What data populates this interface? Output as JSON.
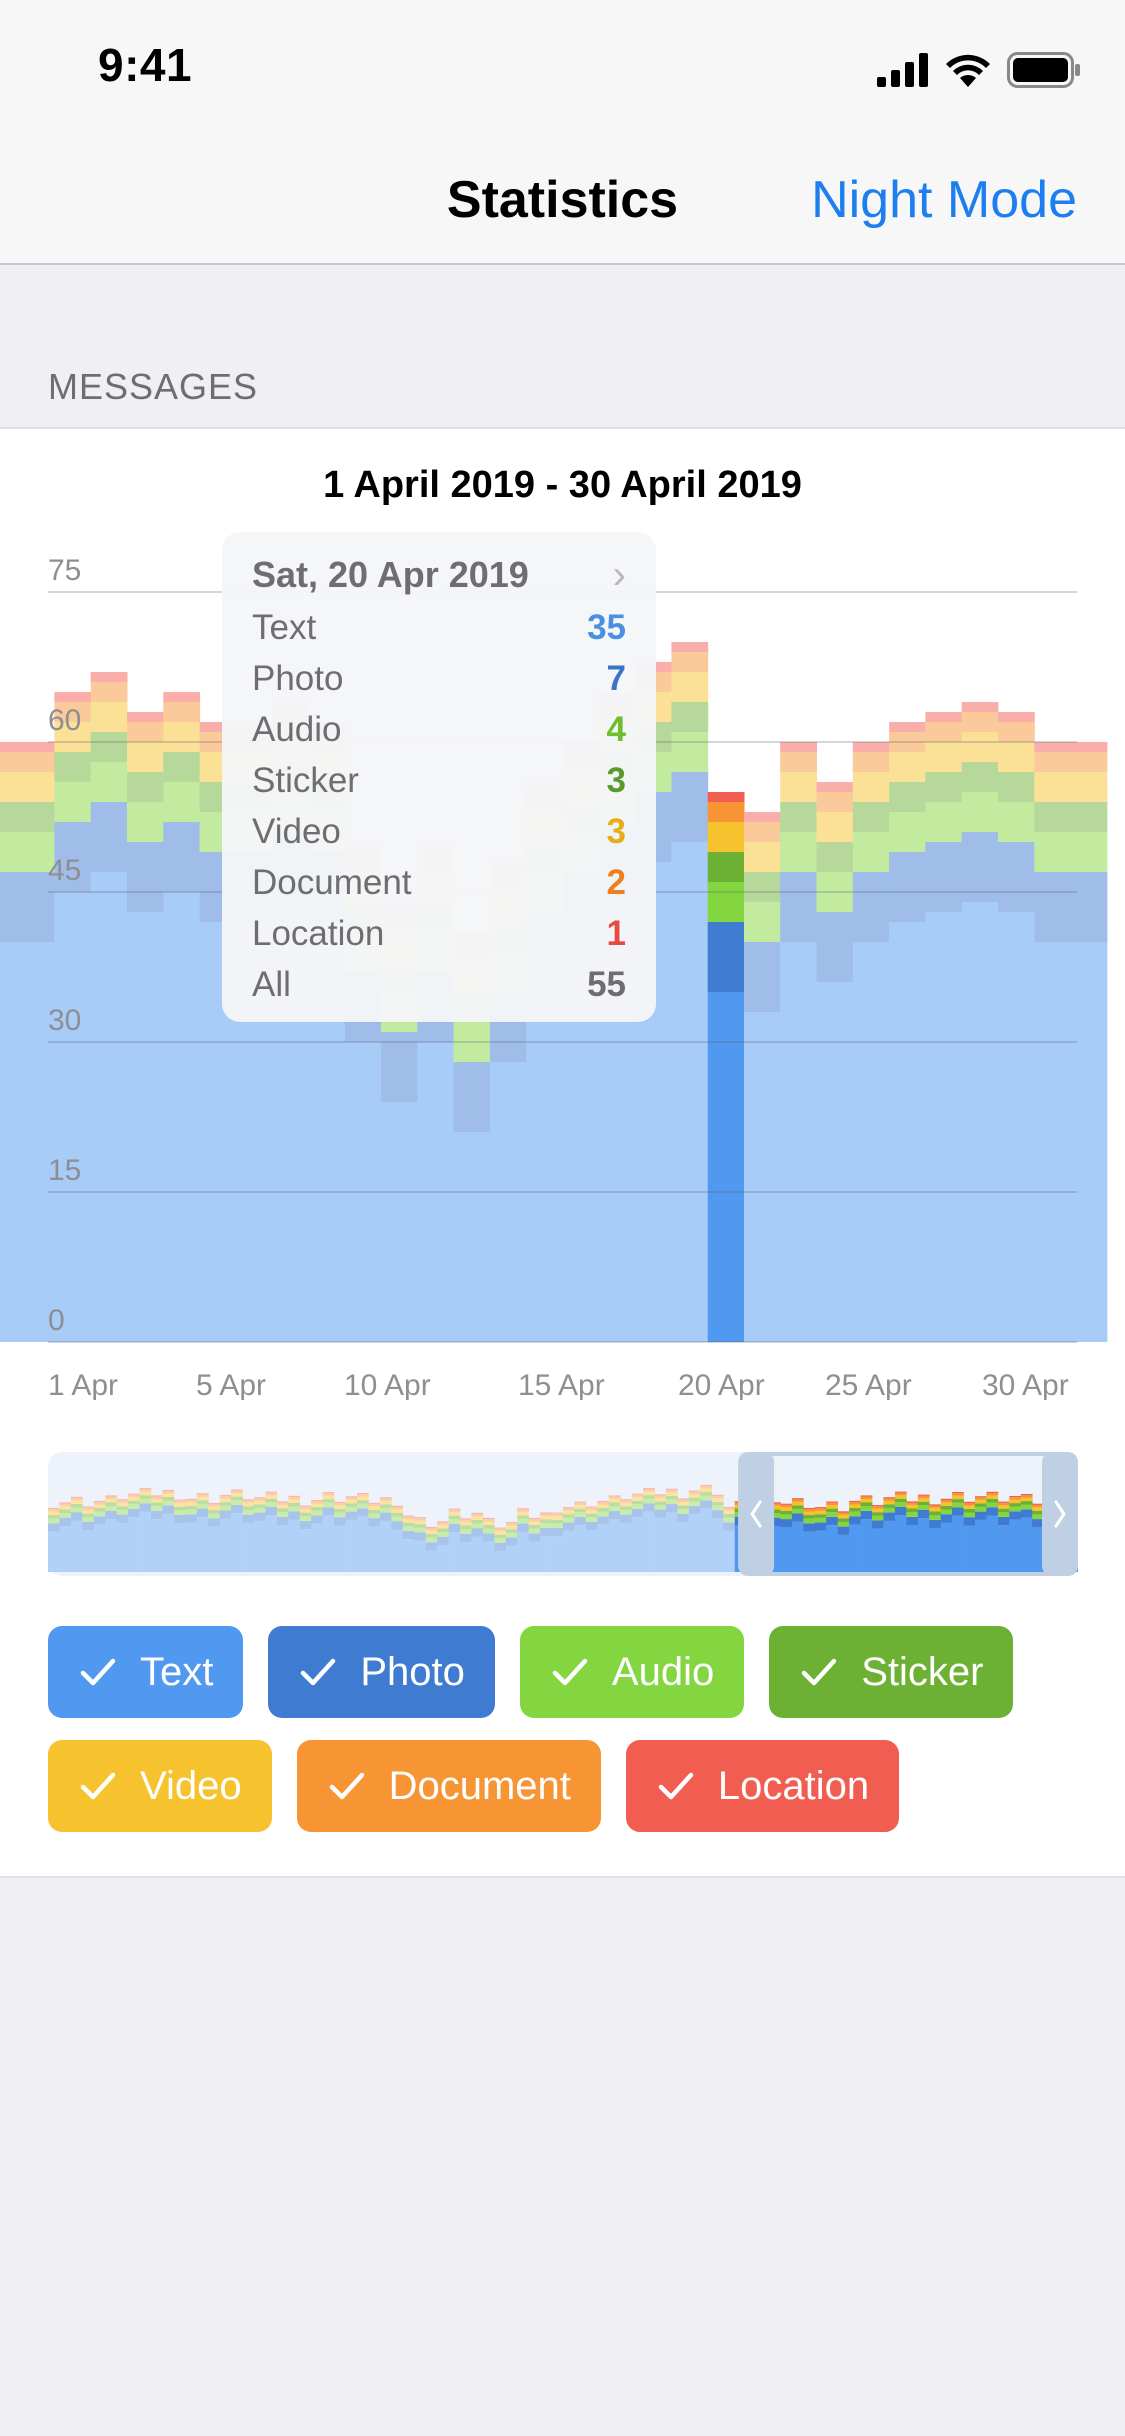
{
  "status": {
    "time": "9:41"
  },
  "nav": {
    "title": "Statistics",
    "action": "Night Mode"
  },
  "section": {
    "header": "MESSAGES"
  },
  "range_title": "1 April 2019 - 30 April 2019",
  "colors": {
    "text": "#5199f0",
    "photo": "#3f7bd1",
    "audio": "#84d641",
    "sticker": "#6db134",
    "video": "#f6c22d",
    "document": "#f79535",
    "location": "#f25d52"
  },
  "tooltip": {
    "date": "Sat, 20 Apr 2019",
    "chevron_icon": "chevron-right-icon",
    "rows": [
      {
        "label": "Text",
        "value": "35",
        "color": "#4a90e2"
      },
      {
        "label": "Photo",
        "value": "7",
        "color": "#3a74c8"
      },
      {
        "label": "Audio",
        "value": "4",
        "color": "#6ac02d"
      },
      {
        "label": "Sticker",
        "value": "3",
        "color": "#5a9a2a"
      },
      {
        "label": "Video",
        "value": "3",
        "color": "#e8ad16"
      },
      {
        "label": "Document",
        "value": "2",
        "color": "#ee7f1c"
      },
      {
        "label": "Location",
        "value": "1",
        "color": "#e84a3f"
      },
      {
        "label": "All",
        "value": "55",
        "color": "#6d6d72"
      }
    ]
  },
  "filters": [
    {
      "label": "Text",
      "color": "#5199f0"
    },
    {
      "label": "Photo",
      "color": "#3f7bd1"
    },
    {
      "label": "Audio",
      "color": "#84d641"
    },
    {
      "label": "Sticker",
      "color": "#6db134"
    },
    {
      "label": "Video",
      "color": "#f6c22d"
    },
    {
      "label": "Document",
      "color": "#f79535"
    },
    {
      "label": "Location",
      "color": "#f25d52"
    }
  ],
  "chart_data": {
    "type": "bar",
    "stacked": true,
    "title": "1 April 2019 - 30 April 2019",
    "y_ticks": [
      "0",
      "15",
      "30",
      "45",
      "60",
      "75"
    ],
    "ylim": [
      0,
      75
    ],
    "x_ticks": [
      "1 Apr",
      "5 Apr",
      "10 Apr",
      "15 Apr",
      "20 Apr",
      "25 Apr",
      "30 Apr"
    ],
    "x": [
      "0 Apr",
      "1 Apr",
      "2 Apr",
      "3 Apr",
      "4 Apr",
      "5 Apr",
      "6 Apr",
      "7 Apr",
      "8 Apr",
      "9 Apr",
      "10 Apr",
      "11 Apr",
      "12 Apr",
      "13 Apr",
      "14 Apr",
      "15 Apr",
      "16 Apr",
      "17 Apr",
      "18 Apr",
      "19 Apr",
      "20 Apr",
      "21 Apr",
      "22 Apr",
      "23 Apr",
      "24 Apr",
      "25 Apr",
      "26 Apr",
      "27 Apr",
      "28 Apr",
      "29 Apr",
      "30 Apr"
    ],
    "highlight_index": 20,
    "series": [
      {
        "name": "Text",
        "values": [
          40,
          40,
          45,
          47,
          43,
          45,
          42,
          42,
          44,
          42,
          30,
          24,
          30,
          21,
          28,
          36,
          40,
          45,
          48,
          50,
          35,
          33,
          40,
          36,
          40,
          42,
          43,
          44,
          43,
          40,
          40
        ]
      },
      {
        "name": "Photo",
        "values": [
          7,
          7,
          7,
          7,
          7,
          7,
          7,
          7,
          7,
          7,
          7,
          7,
          7,
          7,
          7,
          7,
          7,
          7,
          7,
          7,
          7,
          7,
          7,
          7,
          7,
          7,
          7,
          7,
          7,
          7,
          7
        ]
      },
      {
        "name": "Audio",
        "values": [
          4,
          4,
          4,
          4,
          4,
          4,
          4,
          4,
          4,
          4,
          4,
          4,
          4,
          4,
          4,
          4,
          4,
          4,
          4,
          4,
          4,
          4,
          4,
          4,
          4,
          4,
          4,
          4,
          4,
          4,
          4
        ]
      },
      {
        "name": "Sticker",
        "values": [
          3,
          3,
          3,
          3,
          3,
          3,
          3,
          3,
          3,
          3,
          3,
          3,
          3,
          3,
          3,
          3,
          3,
          3,
          3,
          3,
          3,
          3,
          3,
          3,
          3,
          3,
          3,
          3,
          3,
          3,
          3
        ]
      },
      {
        "name": "Video",
        "values": [
          3,
          3,
          3,
          3,
          3,
          3,
          3,
          3,
          3,
          3,
          3,
          3,
          3,
          3,
          3,
          3,
          3,
          3,
          3,
          3,
          3,
          3,
          3,
          3,
          3,
          3,
          3,
          3,
          3,
          3,
          3
        ]
      },
      {
        "name": "Document",
        "values": [
          2,
          2,
          2,
          2,
          2,
          2,
          2,
          2,
          2,
          2,
          2,
          2,
          2,
          2,
          2,
          2,
          2,
          2,
          2,
          2,
          2,
          2,
          2,
          2,
          2,
          2,
          2,
          2,
          2,
          2,
          2
        ]
      },
      {
        "name": "Location",
        "values": [
          1,
          1,
          1,
          1,
          1,
          1,
          1,
          1,
          1,
          1,
          1,
          1,
          1,
          1,
          1,
          1,
          1,
          1,
          1,
          1,
          1,
          1,
          1,
          1,
          1,
          1,
          1,
          1,
          1,
          1,
          1
        ]
      }
    ],
    "navigator": {
      "window_start_fraction": 0.67,
      "window_end_fraction": 1.0
    }
  }
}
